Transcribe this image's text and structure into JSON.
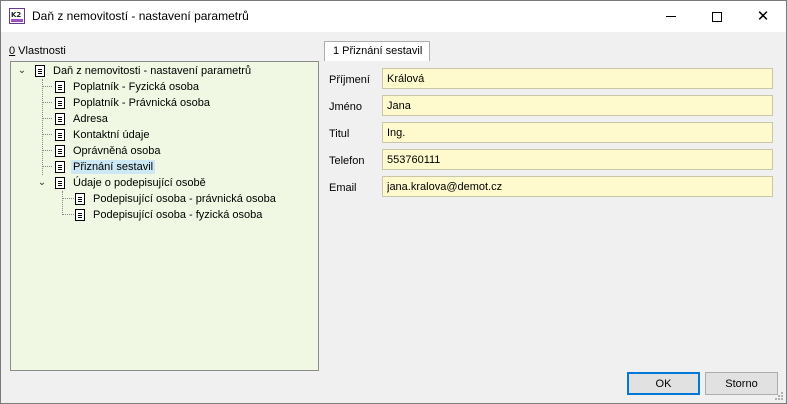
{
  "window": {
    "title": "Daň z nemovitostí - nastavení parametrů",
    "app_icon": "K2",
    "controls": {
      "minimize": "minimize-icon",
      "maximize": "maximize-icon",
      "close": "close-icon"
    }
  },
  "left_panel": {
    "label_key": "0",
    "label_rest": " Vlastnosti",
    "tree": {
      "root": "Daň z nemovitosti - nastavení parametrů",
      "items": [
        "Poplatník - Fyzická osoba",
        "Poplatník - Právnická osoba",
        "Adresa",
        "Kontaktní údaje",
        "Oprávněná osoba",
        "Přiznání sestavil",
        "Údaje o podepisující osobě"
      ],
      "subitems": [
        "Podepisující osoba - právnická osoba",
        "Podepisující osoba - fyzická osoba"
      ],
      "selected": "Přiznání sestavil"
    }
  },
  "right_panel": {
    "tab_label": "1 Přiznání sestavil",
    "fields": [
      {
        "label": "Příjmení",
        "value": "Králová"
      },
      {
        "label": "Jméno",
        "value": "Jana"
      },
      {
        "label": "Titul",
        "value": "Ing."
      },
      {
        "label": "Telefon",
        "value": "553760111"
      },
      {
        "label": "Email",
        "value": "jana.kralova@demot.cz"
      }
    ]
  },
  "buttons": {
    "ok": "OK",
    "cancel": "Storno"
  },
  "colors": {
    "tree_bg": "#f0f8e3",
    "field_bg": "#fffacd",
    "selection": "#cce8f4",
    "focus": "#0078d7"
  }
}
